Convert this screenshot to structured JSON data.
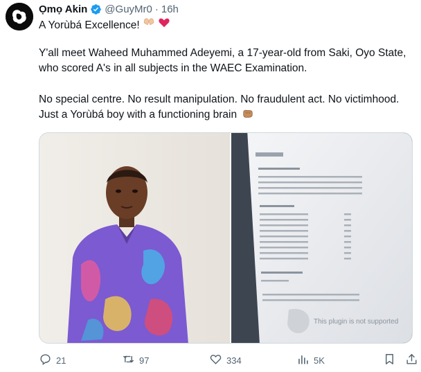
{
  "author": {
    "name": "Ọmọ Akin",
    "handle": "@GuyMr0",
    "separator": "·",
    "time": "16h",
    "verified": true
  },
  "tweet": {
    "line1": "A Yorùbá Excellence!",
    "line1_emojis": [
      "heart-hands-icon",
      "red-heart-icon"
    ],
    "paragraph2": "Y'all meet Waheed Muhammed Adeyemi, a 17-year-old from Saki, Oyo State, who scored A's in all subjects in the WAEC Examination.",
    "paragraph3": "No special centre. No result manipulation. No fraudulent act. No victimhood. Just a Yorùbá boy with a functioning brain",
    "paragraph3_emoji": "fist-bump-icon"
  },
  "media": {
    "left_photo": "boy-in-colorful-shirt",
    "right_photo": "printed-result-sheet",
    "right_photo_printed_text": "This plugin is not supported"
  },
  "actions": {
    "replies": "21",
    "reposts": "97",
    "likes": "334",
    "views": "5K"
  },
  "colors": {
    "text": "#0f1419",
    "secondary": "#536471",
    "verified": "#1d9bf0",
    "border": "#cfd9de"
  }
}
